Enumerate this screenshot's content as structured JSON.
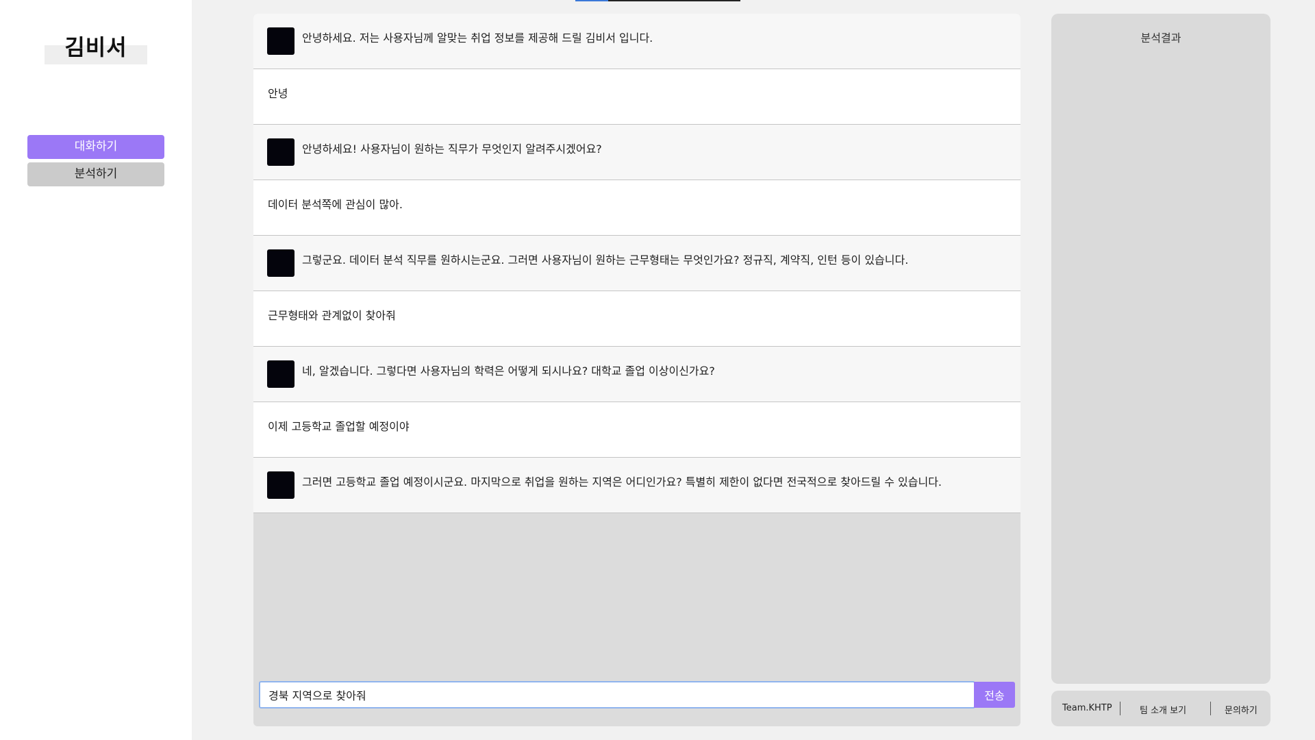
{
  "sidebar": {
    "logo": "김비서",
    "nav": [
      {
        "label": "대화하기",
        "active": true
      },
      {
        "label": "분석하기",
        "active": false
      }
    ]
  },
  "chat": {
    "messages": [
      {
        "role": "bot",
        "text": "안녕하세요. 저는 사용자님께 알맞는 취업 정보를 제공해 드릴 김비서 입니다."
      },
      {
        "role": "user",
        "text": "안녕"
      },
      {
        "role": "bot",
        "text": "안녕하세요! 사용자님이 원하는 직무가 무엇인지 알려주시겠어요?"
      },
      {
        "role": "user",
        "text": "데이터 분석쪽에 관심이 많아."
      },
      {
        "role": "bot",
        "text": "그렇군요. 데이터 분석 직무를 원하시는군요. 그러면 사용자님이 원하는 근무형태는 무엇인가요? 정규직, 계약직, 인턴 등이 있습니다."
      },
      {
        "role": "user",
        "text": "근무형태와 관계없이 찾아줘"
      },
      {
        "role": "bot",
        "text": "네, 알겠습니다. 그렇다면 사용자님의 학력은 어떻게 되시나요? 대학교 졸업 이상이신가요?"
      },
      {
        "role": "user",
        "text": "이제 고등학교 졸업할 예정이야"
      },
      {
        "role": "bot",
        "text": "그러면 고등학교 졸업 예정이시군요. 마지막으로 취업을 원하는 지역은 어디인가요? 특별히 제한이 없다면 전국적으로 찾아드릴 수 있습니다."
      }
    ],
    "input_value": "경북 지역으로 찾아줘",
    "send_label": "전송"
  },
  "result": {
    "title": "분석결과"
  },
  "footer": {
    "team": "Team.KHTP",
    "intro": "팀 소개 보기",
    "contact": "문의하기"
  },
  "colors": {
    "accent": "#9b78f6",
    "bot_avatar": "#04040c"
  }
}
